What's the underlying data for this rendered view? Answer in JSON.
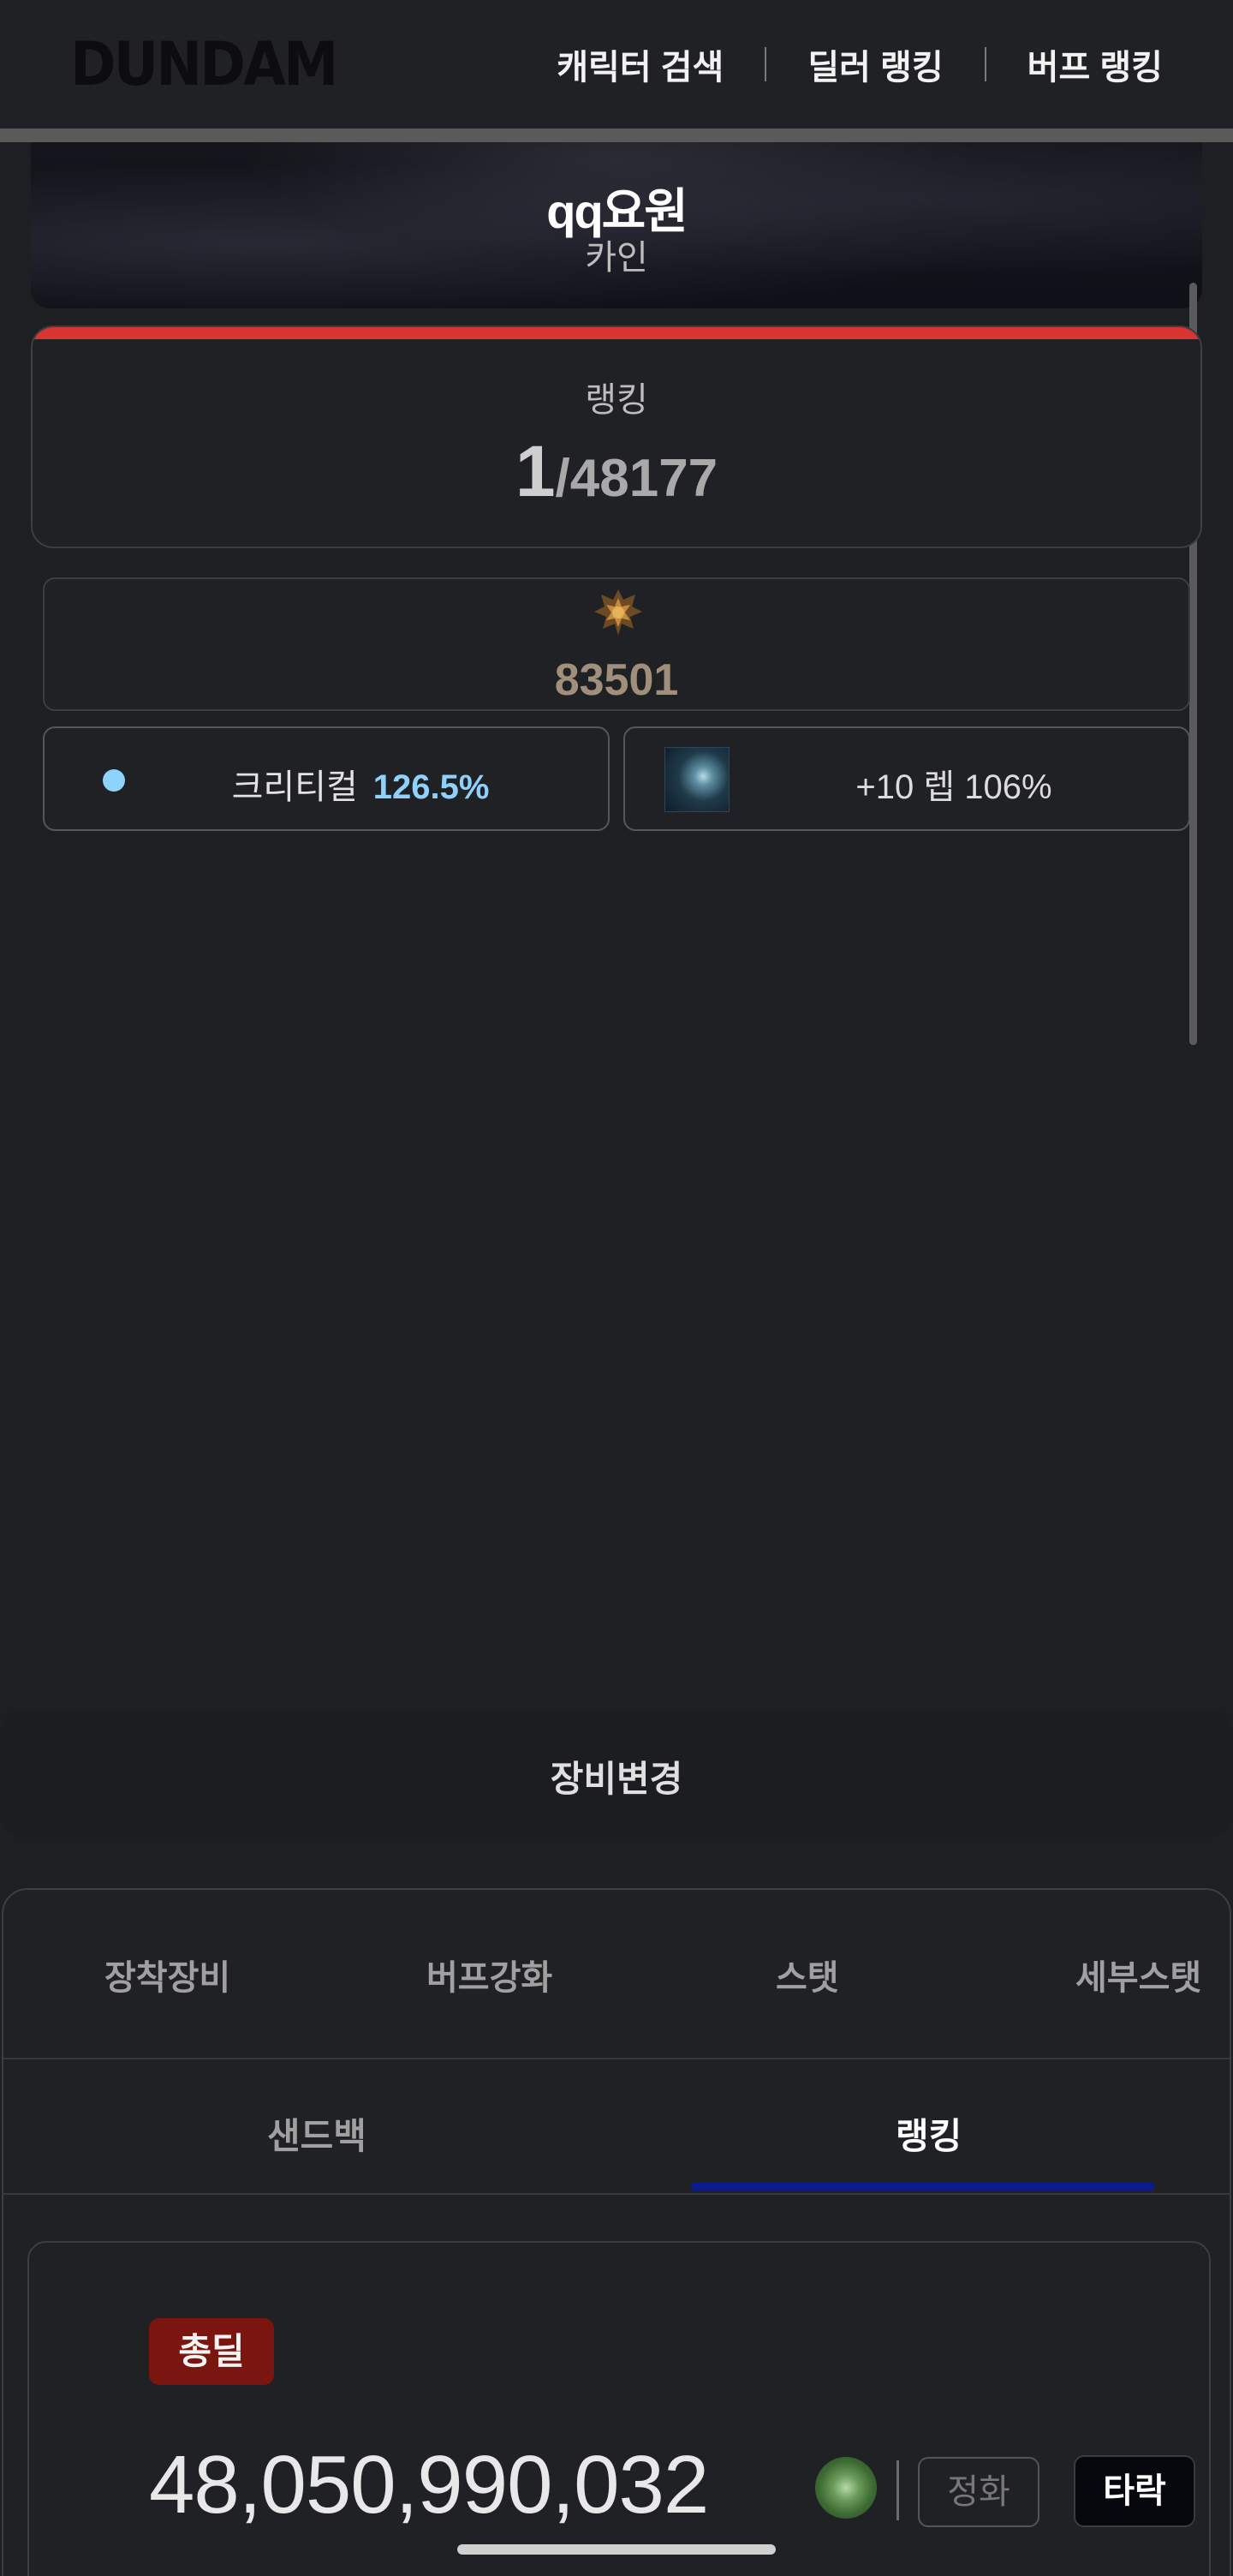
{
  "header": {
    "logo": "DUNDAM",
    "nav": [
      "캐릭터 검색",
      "딜러 랭킹",
      "버프 랭킹"
    ]
  },
  "character": {
    "name": "qq요원",
    "class": "카인"
  },
  "ranking": {
    "label": "랭킹",
    "position": "1",
    "total": "/48177",
    "accent_color": "#d9342f"
  },
  "score": {
    "icon": "rank-emblem-icon",
    "value": "83501"
  },
  "critical": {
    "label": "크리티컬",
    "value": "126.5%",
    "color": "#8fd1fb"
  },
  "skill": {
    "icon": "skill-icon",
    "text": "+10 렙 106%"
  },
  "equip_change": {
    "label": "장비변경"
  },
  "tabs": {
    "row1": [
      "장착장비",
      "버프강화",
      "스탯",
      "세부스탯"
    ],
    "row2": [
      "샌드백",
      "랭킹"
    ],
    "active_row2": "랭킹"
  },
  "result": {
    "badge": "총딜",
    "total_damage": "48,050,990,032",
    "icon": "rose-icon",
    "option_inactive": "정화",
    "option_active": "타락"
  }
}
